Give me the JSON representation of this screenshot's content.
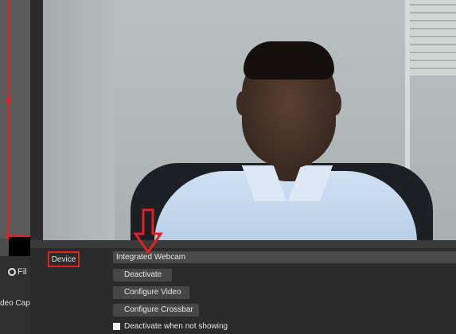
{
  "sidebar": {
    "filters_label": "Fil",
    "source_item_label": "deo Captu"
  },
  "properties": {
    "device_label": "Device",
    "device_value": "Integrated Webcam",
    "deactivate_label": "Deactivate",
    "configure_video_label": "Configure Video",
    "configure_crossbar_label": "Configure Crossbar",
    "deactivate_when_not_showing_label": "Deactivate when not showing",
    "deactivate_when_not_showing_checked": false
  },
  "colors": {
    "annotation": "#e51e1e",
    "panel_bg": "#2b2b2b",
    "button_bg": "#474747"
  }
}
